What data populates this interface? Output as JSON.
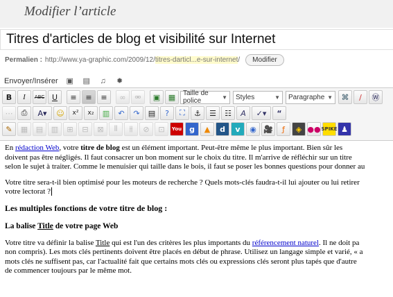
{
  "page": {
    "heading": "Modifier l’article"
  },
  "post_title": "Titres d'articles de blog et visibilité sur Internet",
  "permalink": {
    "label": "Permalien :",
    "base": "http://www.ya-graphic.com/2009/12/",
    "slug": "titres-darticl...e-sur-internet",
    "trailing": "/",
    "edit_button": "Modifier"
  },
  "insert": {
    "label": "Envoyer/Insérer",
    "icons": [
      "image-icon",
      "video-icon",
      "audio-icon",
      "media-icon"
    ]
  },
  "toolbar": {
    "font_size": "Taille de police",
    "styles": "Styles",
    "paragraph": "Paragraphe",
    "bold": "B",
    "italic": "I",
    "strike": "ABC",
    "underline": "U",
    "superscript": "x²",
    "subscript": "x₂",
    "undo": "↶",
    "redo": "↷",
    "quote": "“"
  },
  "content": {
    "p1": {
      "a": "En ",
      "link": "rédaction Web",
      "b": ", votre ",
      "strong": "titre de blog",
      "c": " est un élément important. Peut-être même le plus important. Bien sûr les",
      "line2": "doivent pas être négligés. Il faut consacrer un bon moment sur le choix du titre. Il m'arrive de réfléchir sur un titre",
      "line3": "selon le sujet à traiter. Comme le menuisier qui taille dans le bois, il faut se poser les bonnes questions pour donner au"
    },
    "p2": {
      "line1": "Votre titre sera-t-il bien optimisé pour les moteurs de recherche ? Quels mots-clés faudra-t-il lui ajouter ou lui retirer",
      "line2": "votre lectorat ?"
    },
    "h3": "Les multiples fonctions de votre titre de blog :",
    "h4": {
      "a": "La balise ",
      "u": "Title",
      "b": " de votre page Web"
    },
    "p3": {
      "a": "Votre titre va définir la balise ",
      "u": "Title",
      "b": " qui est l'un des critères les plus importants du ",
      "link": "référencement naturel",
      "c": ". Il ne doit pa",
      "line2": "non compris). Les mots clés pertinents doivent être placés en début de phrase. Utilisez un langage simple et varié, « a",
      "line3": "mots clés ne suffisent pas, car l'actualité fait que certains mots clés ou expressions clés seront plus tapés que d'autre",
      "line4": "de commencer toujours par le même mot."
    }
  },
  "colors": {
    "link": "#0000cc",
    "slug_highlight": "#fffbcc",
    "header_bg": "#f1f1f1"
  }
}
